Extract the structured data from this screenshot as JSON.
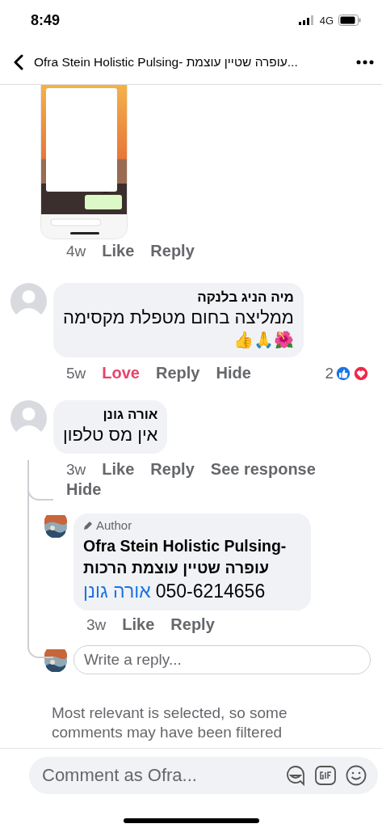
{
  "status_bar": {
    "time": "8:49",
    "network": "4G"
  },
  "header": {
    "title": "Ofra Stein Holistic Pulsing- עופרה שטיין עוצמת..."
  },
  "comments": [
    {
      "attachment": {
        "kind": "picture"
      },
      "time": "4w",
      "reacted": false,
      "actions": [
        "Like",
        "Reply"
      ]
    },
    {
      "kind": "text",
      "author": "מיה הניג בלנקה",
      "text": "ממליצה בחום מטפלת מקסימה",
      "emoji": "🌺🙏👍",
      "time": "5w",
      "reacted": true,
      "actions": [
        "Love",
        "Reply",
        "Hide"
      ],
      "reaction_count": "2"
    },
    {
      "kind": "text",
      "author": "אורה גונן",
      "text": "אין מס טלפון",
      "time": "3w",
      "reacted": false,
      "actions": [
        "Like",
        "Reply",
        "See response",
        "Hide"
      ],
      "replies": [
        {
          "badge": "Author",
          "author": "Ofra Stein Holistic Pulsing- עופרה שטיין עוצמת הרכות",
          "mention": "אורה גונן",
          "text": "050-6214656",
          "time": "3w",
          "reacted": false,
          "actions": [
            "Like",
            "Reply"
          ]
        }
      ],
      "reply_field": {
        "placeholder": "Write a reply..."
      }
    }
  ],
  "notice": "Most relevant is selected, so some comments may have been filtered",
  "composer": {
    "placeholder": "Comment as Ofra..."
  }
}
